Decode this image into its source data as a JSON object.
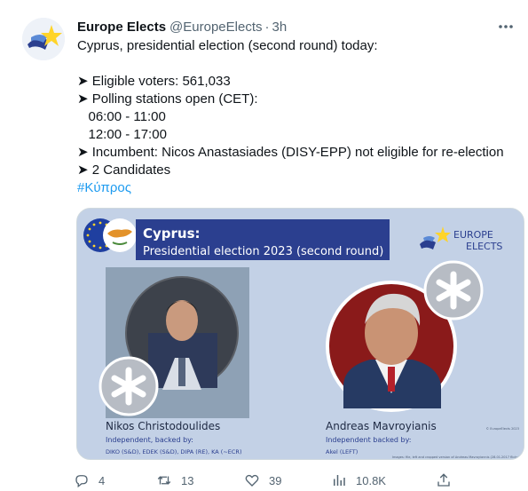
{
  "tweet": {
    "author_name": "Europe Elects",
    "author_handle": "@EuropeElects",
    "separator": "·",
    "time": "3h",
    "lines": [
      "Cyprus, presidential election (second round) today:",
      "",
      "➤ Eligible voters: 561,033",
      "➤ Polling stations open (CET):",
      "   06:00 - 11:00",
      "   12:00 - 17:00",
      "➤ Incumbent: Nicos Anastasiades (DISY-EPP) not eligible for re-election",
      "➤ 2 Candidates"
    ],
    "hashtag": "#Κύπρος"
  },
  "card": {
    "title_country": "Cyprus:",
    "title_event": "Presidential election 2023 (second round)",
    "logo_text_1": "EUROPE",
    "logo_text_2": "ELECTS",
    "candidates": [
      {
        "name": "Nikos Christodoulides",
        "backing_label": "Independent, backed by:",
        "parties": "DIKO (S&D), EDEK (S&D), DIPA (RE), KA (~ECR)"
      },
      {
        "name": "Andreas Mavroyianis",
        "backing_label": "Independent backed by:",
        "parties": "Akel (LEFT)"
      }
    ],
    "credit_1": "© EuropeElects 2023",
    "credit_2": "Images: file, left and cropped version of Andreas Mavroyiannis (28.01.2017 flickr)"
  },
  "stats": {
    "replies": "4",
    "retweets": "13",
    "likes": "39",
    "views": "10.8K"
  },
  "colors": {
    "accent": "#1d9bf0",
    "muted": "#536471",
    "card_bg": "#c3d1e6",
    "banner": "#2b3f8f",
    "flag_orange": "#e3922a",
    "star_yellow": "#ffd42a"
  }
}
